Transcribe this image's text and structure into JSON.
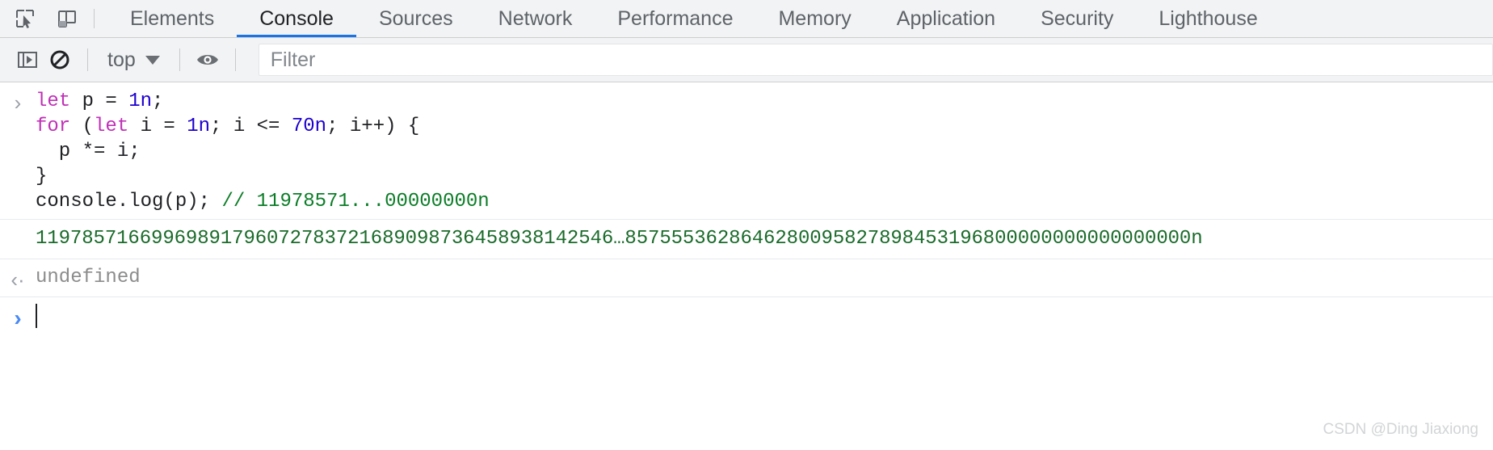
{
  "tabbar": {
    "inspect_icon": "inspect-cursor-icon",
    "device_icon": "device-toolbar-icon",
    "tabs": [
      {
        "label": "Elements",
        "active": false
      },
      {
        "label": "Console",
        "active": true
      },
      {
        "label": "Sources",
        "active": false
      },
      {
        "label": "Network",
        "active": false
      },
      {
        "label": "Performance",
        "active": false
      },
      {
        "label": "Memory",
        "active": false
      },
      {
        "label": "Application",
        "active": false
      },
      {
        "label": "Security",
        "active": false
      },
      {
        "label": "Lighthouse",
        "active": false
      }
    ],
    "active_tab_color": "#1a73e8"
  },
  "toolbar": {
    "sidebar_icon": "console-sidebar-icon",
    "clear_icon": "clear-console-icon",
    "context_label": "top",
    "context_caret_icon": "chevron-down-icon",
    "eye_icon": "live-expression-eye-icon",
    "filter_placeholder": "Filter",
    "filter_value": ""
  },
  "console": {
    "input_prompt_icon": "input-chevron-icon",
    "output_prompt_icon": "return-value-arrow-icon",
    "prompt_icon": "prompt-chevron-icon",
    "command_lines": [
      [
        {
          "t": "let ",
          "c": "kw"
        },
        {
          "t": "p = ",
          "c": ""
        },
        {
          "t": "1n",
          "c": "num"
        },
        {
          "t": ";",
          "c": ""
        }
      ],
      [
        {
          "t": "for ",
          "c": "kw"
        },
        {
          "t": "(",
          "c": ""
        },
        {
          "t": "let ",
          "c": "kw"
        },
        {
          "t": "i = ",
          "c": ""
        },
        {
          "t": "1n",
          "c": "num"
        },
        {
          "t": "; i <= ",
          "c": ""
        },
        {
          "t": "70n",
          "c": "num"
        },
        {
          "t": "; i++) {",
          "c": ""
        }
      ],
      [
        {
          "t": "  p *= i;",
          "c": ""
        }
      ],
      [
        {
          "t": "}",
          "c": ""
        }
      ],
      [
        {
          "t": "console.log(p); ",
          "c": ""
        },
        {
          "t": "// 11978571...00000000n",
          "c": "cmt"
        }
      ]
    ],
    "output_value": "11978571669969891796072783721689098736458938142546…8575553628646280095827898453196800000000000000000n",
    "return_value": "undefined",
    "colors": {
      "keyword": "#c031b7",
      "number": "#1c00cf",
      "comment": "#0b7d27",
      "bigint": "#1a6b2a",
      "undefined": "#8c8c8c"
    }
  },
  "watermark": {
    "text": "CSDN @Ding Jiaxiong"
  }
}
